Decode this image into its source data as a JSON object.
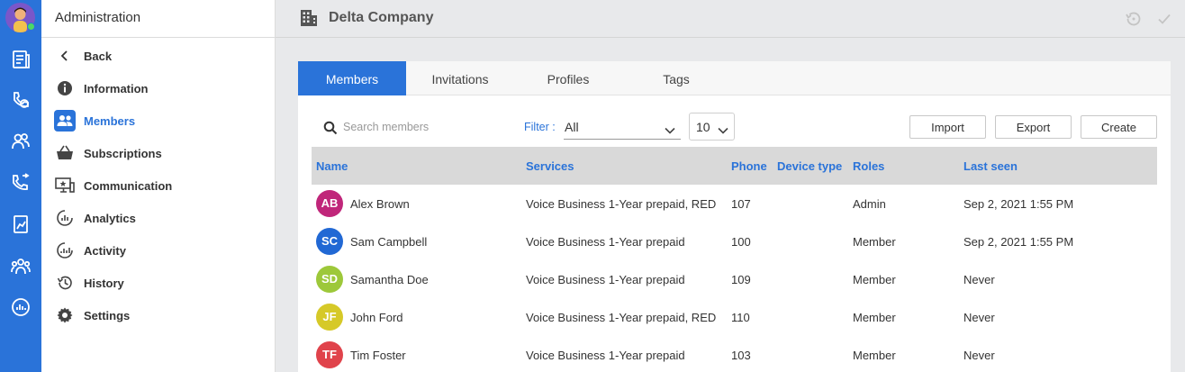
{
  "sidebar": {
    "title": "Administration",
    "items": [
      {
        "label": "Back",
        "icon": "chevron-left-icon"
      },
      {
        "label": "Information",
        "icon": "info-icon"
      },
      {
        "label": "Members",
        "icon": "members-icon"
      },
      {
        "label": "Subscriptions",
        "icon": "basket-icon"
      },
      {
        "label": "Communication",
        "icon": "monitor-star-icon"
      },
      {
        "label": "Analytics",
        "icon": "analytics-icon"
      },
      {
        "label": "Activity",
        "icon": "activity-icon"
      },
      {
        "label": "History",
        "icon": "history-icon"
      },
      {
        "label": "Settings",
        "icon": "gear-icon"
      }
    ]
  },
  "header": {
    "company": "Delta Company",
    "icons": [
      "building-icon",
      "restore-icon",
      "check-icon"
    ]
  },
  "tabs": [
    "Members",
    "Invitations",
    "Profiles",
    "Tags"
  ],
  "toolbar": {
    "search_placeholder": "Search members",
    "filter_label": "Filter :",
    "filter_value": "All",
    "page_size": "10",
    "import_label": "Import",
    "export_label": "Export",
    "create_label": "Create"
  },
  "table": {
    "columns": [
      "Name",
      "Services",
      "Phone",
      "Device type",
      "Roles",
      "Last seen"
    ],
    "rows": [
      {
        "initials": "AB",
        "color": "#c0267a",
        "name": "Alex Brown",
        "services": "Voice Business 1-Year prepaid, RED",
        "phone": "107",
        "device": "",
        "role": "Admin",
        "last_seen": "Sep 2, 2021 1:55 PM"
      },
      {
        "initials": "SC",
        "color": "#2168d4",
        "name": "Sam Campbell",
        "services": "Voice Business 1-Year prepaid",
        "phone": "100",
        "device": "",
        "role": "Member",
        "last_seen": "Sep 2, 2021 1:55 PM"
      },
      {
        "initials": "SD",
        "color": "#9dc83a",
        "name": "Samantha Doe",
        "services": "Voice Business 1-Year prepaid",
        "phone": "109",
        "device": "",
        "role": "Member",
        "last_seen": "Never"
      },
      {
        "initials": "JF",
        "color": "#d6c928",
        "name": "John Ford",
        "services": "Voice Business 1-Year prepaid, RED",
        "phone": "110",
        "device": "",
        "role": "Member",
        "last_seen": "Never"
      },
      {
        "initials": "TF",
        "color": "#e0434b",
        "name": "Tim Foster",
        "services": "Voice Business 1-Year prepaid",
        "phone": "103",
        "device": "",
        "role": "Member",
        "last_seen": "Never"
      }
    ]
  },
  "colors": {
    "accent": "#2a73d9",
    "rail": "#2a73d9"
  }
}
